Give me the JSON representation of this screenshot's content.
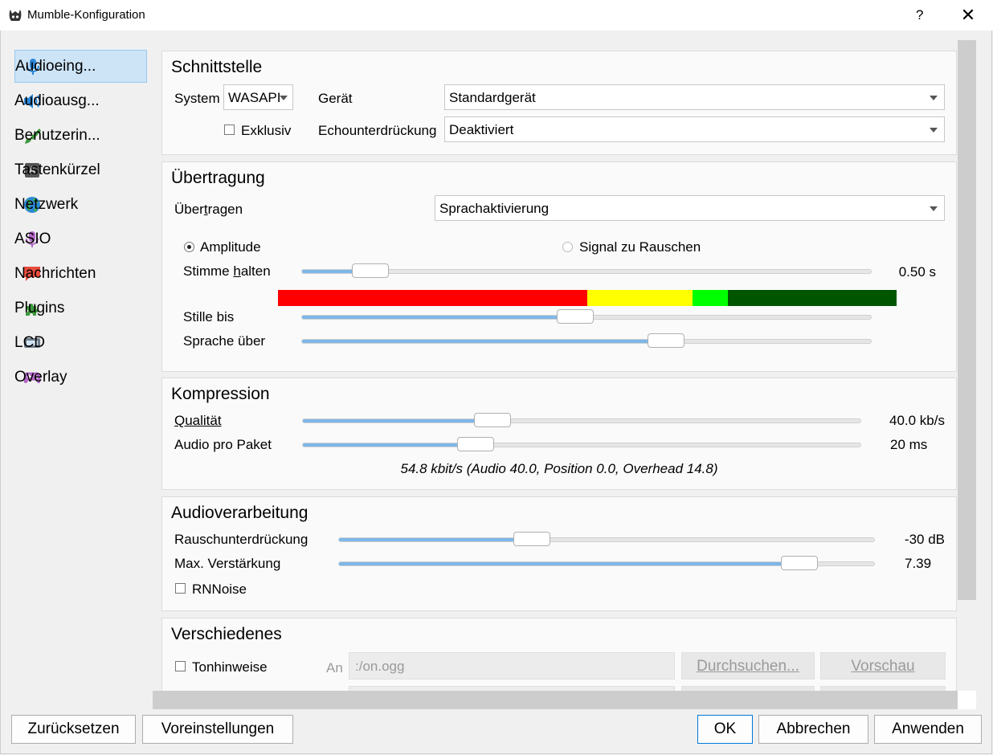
{
  "window": {
    "title": "Mumble-Konfiguration",
    "help": "?",
    "close": "✕"
  },
  "sidebar": {
    "items": [
      {
        "label": "Audioeing...",
        "icon": "microphone-icon",
        "active": true
      },
      {
        "label": "Audioausg...",
        "icon": "speaker-icon"
      },
      {
        "label": "Benutzerin...",
        "icon": "brush-icon"
      },
      {
        "label": "Tastenkürzel",
        "icon": "keyboard-key-icon"
      },
      {
        "label": "Netzwerk",
        "icon": "globe-icon"
      },
      {
        "label": "ASIO",
        "icon": "asio-microphone-icon"
      },
      {
        "label": "Nachrichten",
        "icon": "chat-bubble-icon"
      },
      {
        "label": "Plugins",
        "icon": "puzzle-icon"
      },
      {
        "label": "LCD",
        "icon": "lcd-icon"
      },
      {
        "label": "Overlay",
        "icon": "gamepad-icon"
      }
    ]
  },
  "interface": {
    "title": "Schnittstelle",
    "system_label": "System",
    "system_value": "WASAPI",
    "device_label": "Gerät",
    "device_value": "Standardgerät",
    "exclusive_label": "Exklusiv",
    "echo_label": "Echounterdrückung",
    "echo_value": "Deaktiviert"
  },
  "transmission": {
    "title": "Übertragung",
    "transmit_label_pre": "Über",
    "transmit_label_u": "t",
    "transmit_label_post": "ragen",
    "transmit_value": "Sprachaktivierung",
    "amplitude_label": "Amplitude",
    "snr_label": "Signal zu Rauschen",
    "hold_label_pre": "Stimme ",
    "hold_label_u": "h",
    "hold_label_post": "alten",
    "hold_value": "0.50 s",
    "hold_level": 0.12,
    "silence_label": "Stille bis",
    "silence_level": 0.48,
    "speech_label": "Sprache über",
    "speech_level": 0.64,
    "meter": [
      {
        "color": "#ff0000",
        "fraction": 0.5
      },
      {
        "color": "#ffff00",
        "fraction": 0.17
      },
      {
        "color": "#00ff00",
        "fraction": 0.057
      },
      {
        "color": "#005500",
        "fraction": 0.273
      }
    ]
  },
  "compression": {
    "title": "Kompression",
    "quality_label": "Qualität",
    "quality_value": "40.0 kb/s",
    "quality_level": 0.34,
    "frames_label": "Audio pro Paket",
    "frames_value": "20 ms",
    "frames_level": 0.31,
    "summary": "54.8 kbit/s (Audio 40.0, Position 0.0, Overhead 14.8)"
  },
  "processing": {
    "title": "Audioverarbeitung",
    "noise_label": "Rauschunterdrückung",
    "noise_value": "-30 dB",
    "noise_level": 0.36,
    "amp_label": "Max. Verstärkung",
    "amp_value": "7.39",
    "amp_level": 0.86,
    "rnnoise_label": "RNNoise"
  },
  "misc": {
    "title": "Verschiedenes",
    "cues_label": "Tonhinweise",
    "on_label": "An",
    "on_file": ":/on.ogg",
    "browse_label": "Durchsuchen...",
    "preview_label": "Vorschau"
  },
  "buttons": {
    "reset": "Zurücksetzen",
    "defaults": "Voreinstellungen",
    "ok": "OK",
    "cancel": "Abbrechen",
    "apply": "Anwenden"
  }
}
